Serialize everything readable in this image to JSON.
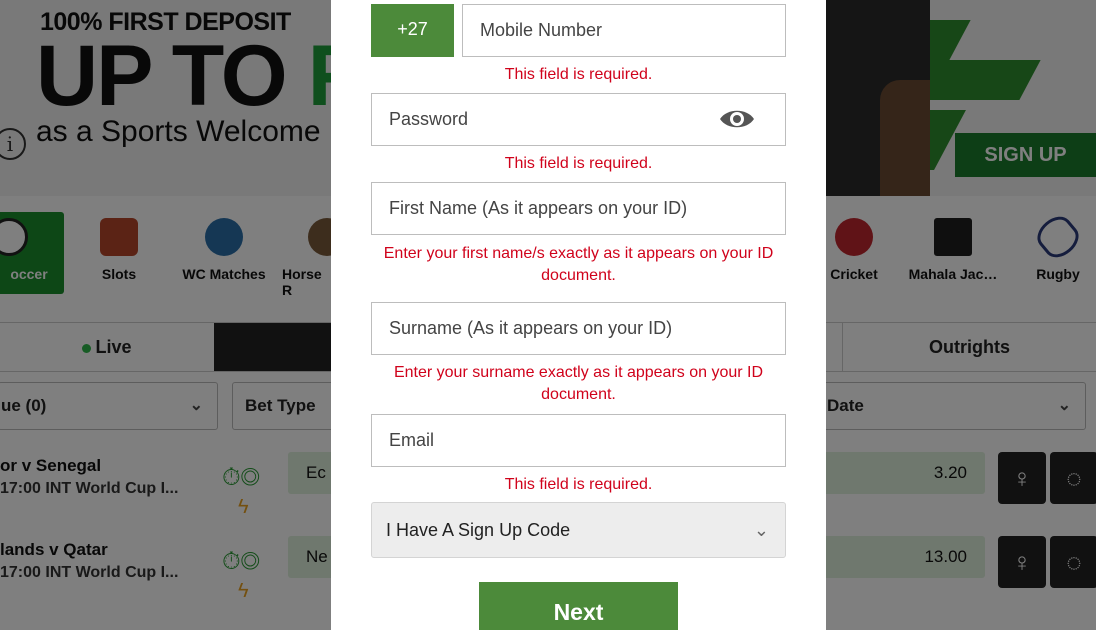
{
  "banner": {
    "line1": "100% FIRST DEPOSIT",
    "line2a": "UP TO ",
    "line2b": "R",
    "line3": "as a Sports Welcome B",
    "info_glyph": "i",
    "signup_label": "SIGN UP"
  },
  "categories": [
    {
      "label": "occer",
      "icon": "soccer-ball-icon"
    },
    {
      "label": "Slots",
      "icon": "slot-machine-icon"
    },
    {
      "label": "WC Matches",
      "icon": "globe-icon"
    },
    {
      "label": "Horse R",
      "icon": "horse-icon"
    },
    {
      "label": "Cricket",
      "icon": "cricket-ball-icon"
    },
    {
      "label": "Mahala Jac…",
      "icon": "mahala-jackpot-icon"
    },
    {
      "label": "Rugby",
      "icon": "rugby-ball-icon"
    }
  ],
  "tabs": {
    "live": "Live",
    "outrights": "Outrights"
  },
  "filters": {
    "league": "ue (0)",
    "bet_type": "Bet Type",
    "date": "Date"
  },
  "matches": [
    {
      "title": "or v Senegal",
      "sub": "17:00 INT World Cup I...",
      "team": "Ec",
      "odds": "3.20"
    },
    {
      "title": "lands v Qatar",
      "sub": "17:00 INT World Cup I...",
      "team": "Ne",
      "odds": "13.00"
    }
  ],
  "form": {
    "country_code": "+27",
    "mobile_placeholder": "Mobile Number",
    "mobile_error": "This field is required.",
    "password_placeholder": "Password",
    "password_error": "This field is required.",
    "first_name_placeholder": "First Name (As it appears on your ID)",
    "first_name_error": "Enter your first name/s exactly as it appears on your ID document.",
    "surname_placeholder": "Surname (As it appears on your ID)",
    "surname_error": "Enter your surname exactly as it appears on your ID document.",
    "email_placeholder": "Email",
    "email_error": "This field is required.",
    "signup_code_select": "I Have A Sign Up Code",
    "next_label": "Next"
  },
  "colors": {
    "brand_green": "#4c8a3a",
    "error_red": "#d0021b",
    "banner_green": "#1b7d2c"
  }
}
